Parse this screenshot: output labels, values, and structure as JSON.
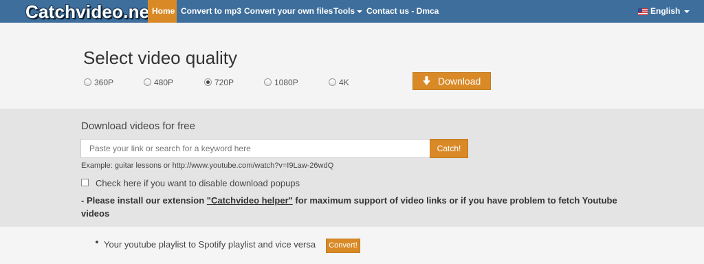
{
  "nav": {
    "logo": "Catchvideo.net",
    "items": [
      {
        "label": "Home",
        "active": true
      },
      {
        "label": "Convert to mp3"
      },
      {
        "label": "Convert your own files"
      },
      {
        "label": "Tools",
        "dropdown": true
      },
      {
        "label": "Contact us - Dmca"
      }
    ],
    "language": "English"
  },
  "quality": {
    "title": "Select video quality",
    "options": [
      "360P",
      "480P",
      "720P",
      "1080P",
      "4K"
    ],
    "selected": "720P",
    "download_label": "Download"
  },
  "main": {
    "subtitle": "Download videos for free",
    "search_placeholder": "Paste your link or search for a keyword here",
    "search_value": "",
    "catch_label": "Catch!",
    "example": "Example: guitar lessons or http://www.youtube.com/watch?v=I9Law-26wdQ",
    "checkbox_label": "Check here if you want to disable download popups",
    "checkbox_checked": false,
    "notice_prefix": "- Please install our extension ",
    "notice_link": "\"Catchvideo helper\"",
    "notice_suffix": " for maximum support of video links or if you have problem to fetch Youtube videos"
  },
  "playlist": {
    "text": "Your youtube playlist to Spotify playlist and vice versa",
    "button": "Convert!"
  },
  "colors": {
    "navbar": "#3d6e9c",
    "accent": "#d98a27",
    "section_gray": "#e4e4e4"
  }
}
